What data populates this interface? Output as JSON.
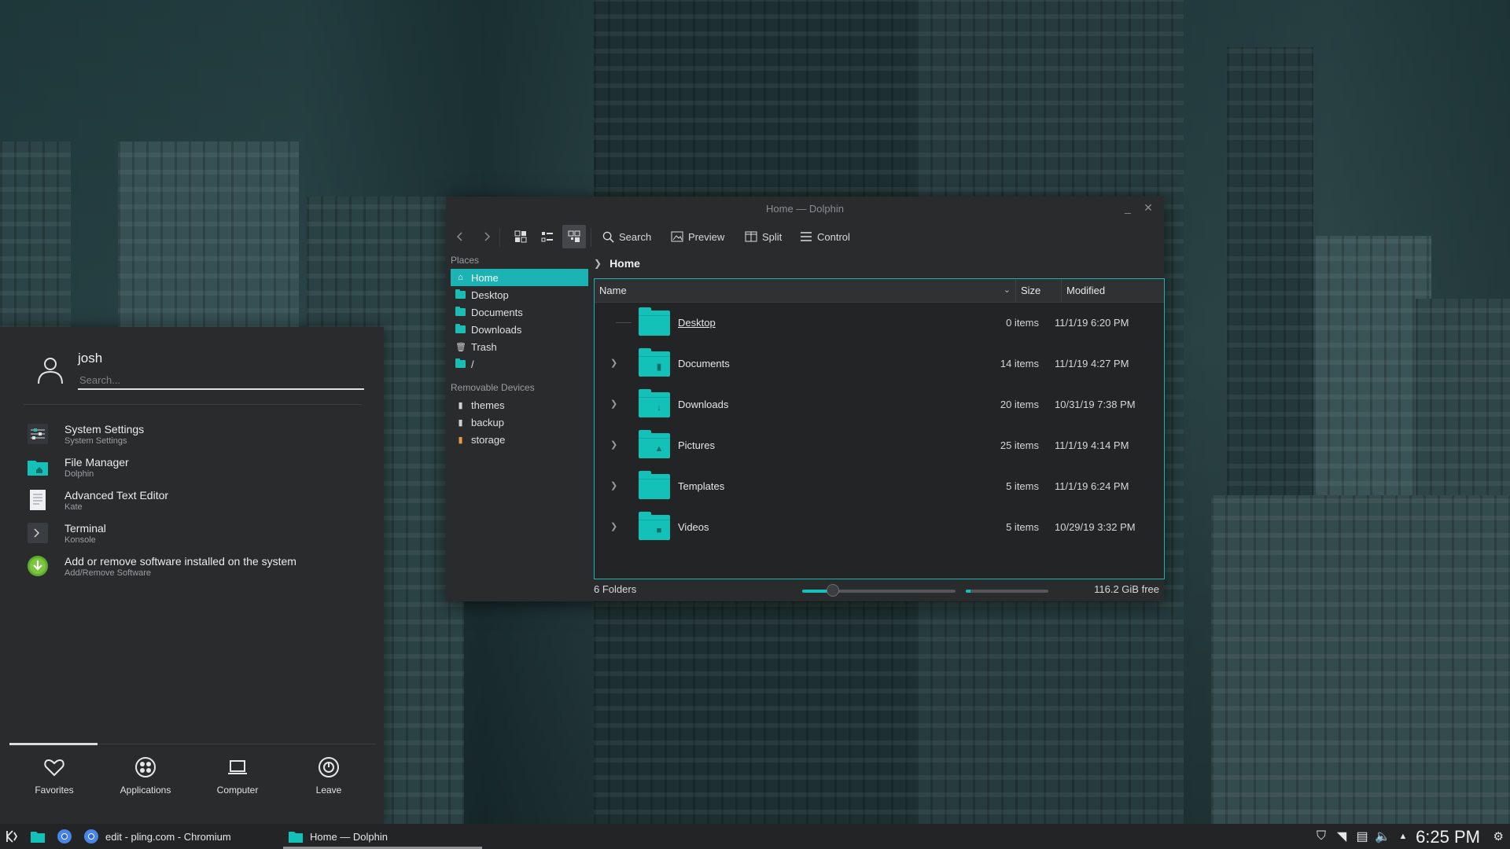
{
  "dolphin": {
    "title": "Home — Dolphin",
    "toolbar": {
      "search": "Search",
      "preview": "Preview",
      "split": "Split",
      "control": "Control"
    },
    "places_header": "Places",
    "places": [
      {
        "label": "Home",
        "icon": "home-icon"
      },
      {
        "label": "Desktop",
        "icon": "folder-icon"
      },
      {
        "label": "Documents",
        "icon": "folder-icon"
      },
      {
        "label": "Downloads",
        "icon": "folder-icon"
      },
      {
        "label": "Trash",
        "icon": "trash-icon"
      },
      {
        "label": "/",
        "icon": "folder-icon"
      }
    ],
    "devices_header": "Removable Devices",
    "devices": [
      {
        "label": "themes",
        "icon": "usb-drive-icon"
      },
      {
        "label": "backup",
        "icon": "usb-drive-icon"
      },
      {
        "label": "storage",
        "icon": "drive-icon"
      }
    ],
    "breadcrumb": "Home",
    "columns": {
      "name": "Name",
      "size": "Size",
      "modified": "Modified"
    },
    "files": [
      {
        "name": "Desktop",
        "size": "0 items",
        "modified": "11/1/19 6:20 PM"
      },
      {
        "name": "Documents",
        "size": "14 items",
        "modified": "11/1/19 4:27 PM"
      },
      {
        "name": "Downloads",
        "size": "20 items",
        "modified": "10/31/19 7:38 PM"
      },
      {
        "name": "Pictures",
        "size": "25 items",
        "modified": "11/1/19 4:14 PM"
      },
      {
        "name": "Templates",
        "size": "5 items",
        "modified": "11/1/19 6:24 PM"
      },
      {
        "name": "Videos",
        "size": "5 items",
        "modified": "10/29/19 3:32 PM"
      }
    ],
    "status_text": "6 Folders",
    "free_space": "116.2 GiB free",
    "zoom_level": 0.2,
    "space_used": 0.06
  },
  "launcher": {
    "username": "josh",
    "search_placeholder": "Search...",
    "apps": [
      {
        "title": "System Settings",
        "subtitle": "System Settings",
        "icon": "settings-icon"
      },
      {
        "title": "File Manager",
        "subtitle": "Dolphin",
        "icon": "file-manager-icon"
      },
      {
        "title": "Advanced Text Editor",
        "subtitle": "Kate",
        "icon": "text-editor-icon"
      },
      {
        "title": "Terminal",
        "subtitle": "Konsole",
        "icon": "terminal-icon"
      },
      {
        "title": "Add or remove software installed on the system",
        "subtitle": "Add/Remove Software",
        "icon": "software-install-icon"
      }
    ],
    "tabs": [
      {
        "label": "Favorites",
        "icon": "heart-icon"
      },
      {
        "label": "Applications",
        "icon": "apps-icon"
      },
      {
        "label": "Computer",
        "icon": "laptop-icon"
      },
      {
        "label": "Leave",
        "icon": "power-icon"
      }
    ]
  },
  "taskbar": {
    "tasks": [
      {
        "label": "edit - pling.com - Chromium",
        "icon": "chromium-icon"
      },
      {
        "label": "Home — Dolphin",
        "icon": "dolphin-icon"
      }
    ],
    "clock": "6:25 PM"
  },
  "colors": {
    "accent": "#14c1b8",
    "window_bg": "#2a2b2d",
    "view_bg": "#232426"
  }
}
